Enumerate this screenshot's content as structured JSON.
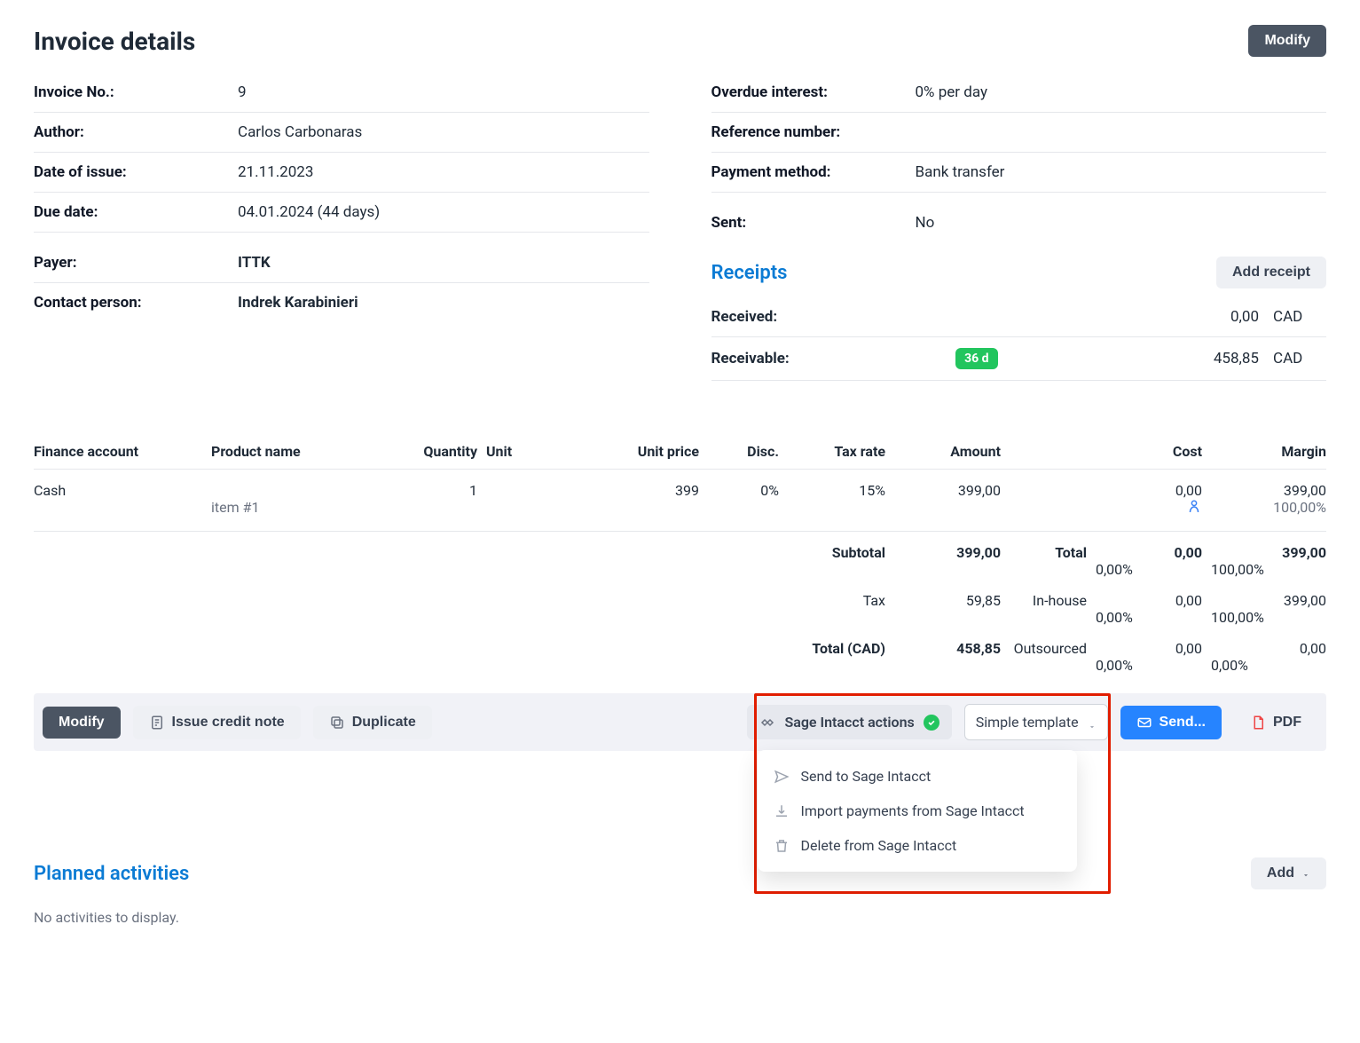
{
  "title": "Invoice details",
  "buttons": {
    "modify": "Modify",
    "add_receipt": "Add receipt",
    "issue_credit": "Issue credit note",
    "duplicate": "Duplicate",
    "sage_actions": "Sage Intacct actions",
    "template": "Simple template",
    "send": "Send...",
    "pdf": "PDF",
    "add": "Add"
  },
  "left": {
    "invoice_no_label": "Invoice No.:",
    "invoice_no": "9",
    "author_label": "Author:",
    "author": "Carlos Carbonaras",
    "date_issue_label": "Date of issue:",
    "date_issue": "21.11.2023",
    "due_date_label": "Due date:",
    "due_date": "04.01.2024 (44 days)",
    "payer_label": "Payer:",
    "payer": "ITTK",
    "contact_label": "Contact person:",
    "contact": "Indrek Karabinieri"
  },
  "right": {
    "overdue_label": "Overdue interest:",
    "overdue": "0% per day",
    "reference_label": "Reference number:",
    "reference": "",
    "payment_label": "Payment method:",
    "payment": "Bank transfer",
    "sent_label": "Sent:",
    "sent": "No"
  },
  "receipts": {
    "title": "Receipts",
    "received_label": "Received:",
    "received_value": "0,00",
    "received_ccy": "CAD",
    "receivable_label": "Receivable:",
    "receivable_badge": "36 d",
    "receivable_value": "458,85",
    "receivable_ccy": "CAD"
  },
  "table": {
    "headers": {
      "finance": "Finance account",
      "product": "Product name",
      "qty": "Quantity",
      "unit": "Unit",
      "unit_price": "Unit price",
      "disc": "Disc.",
      "tax": "Tax rate",
      "amount": "Amount",
      "cost": "Cost",
      "margin": "Margin"
    },
    "row": {
      "finance": "Cash",
      "product": "",
      "qty": "1",
      "unit": "",
      "unit_price": "399",
      "disc": "0%",
      "tax": "15%",
      "amount": "399,00",
      "cost": "0,00",
      "margin": "399,00",
      "item_sub": "item #1",
      "margin_pct": "100,00%"
    }
  },
  "totals": {
    "subtotal_label": "Subtotal",
    "subtotal_amount": "399,00",
    "total_label": "Total",
    "total_cost": "0,00",
    "total_cost_pct": "0,00%",
    "total_margin": "399,00",
    "total_margin_pct": "100,00%",
    "tax_label": "Tax",
    "tax_amount": "59,85",
    "inhouse_label": "In-house",
    "inhouse_cost": "0,00",
    "inhouse_cost_pct": "0,00%",
    "inhouse_margin": "399,00",
    "inhouse_margin_pct": "100,00%",
    "grand_label": "Total (CAD)",
    "grand_amount": "458,85",
    "out_label": "Outsourced",
    "out_cost": "0,00",
    "out_cost_pct": "0,00%",
    "out_margin": "0,00",
    "out_margin_pct": "0,00%"
  },
  "sage_menu": {
    "send": "Send to Sage Intacct",
    "import": "Import payments from Sage Intacct",
    "delete": "Delete from Sage Intacct"
  },
  "planned": {
    "title": "Planned activities",
    "empty": "No activities to display."
  }
}
